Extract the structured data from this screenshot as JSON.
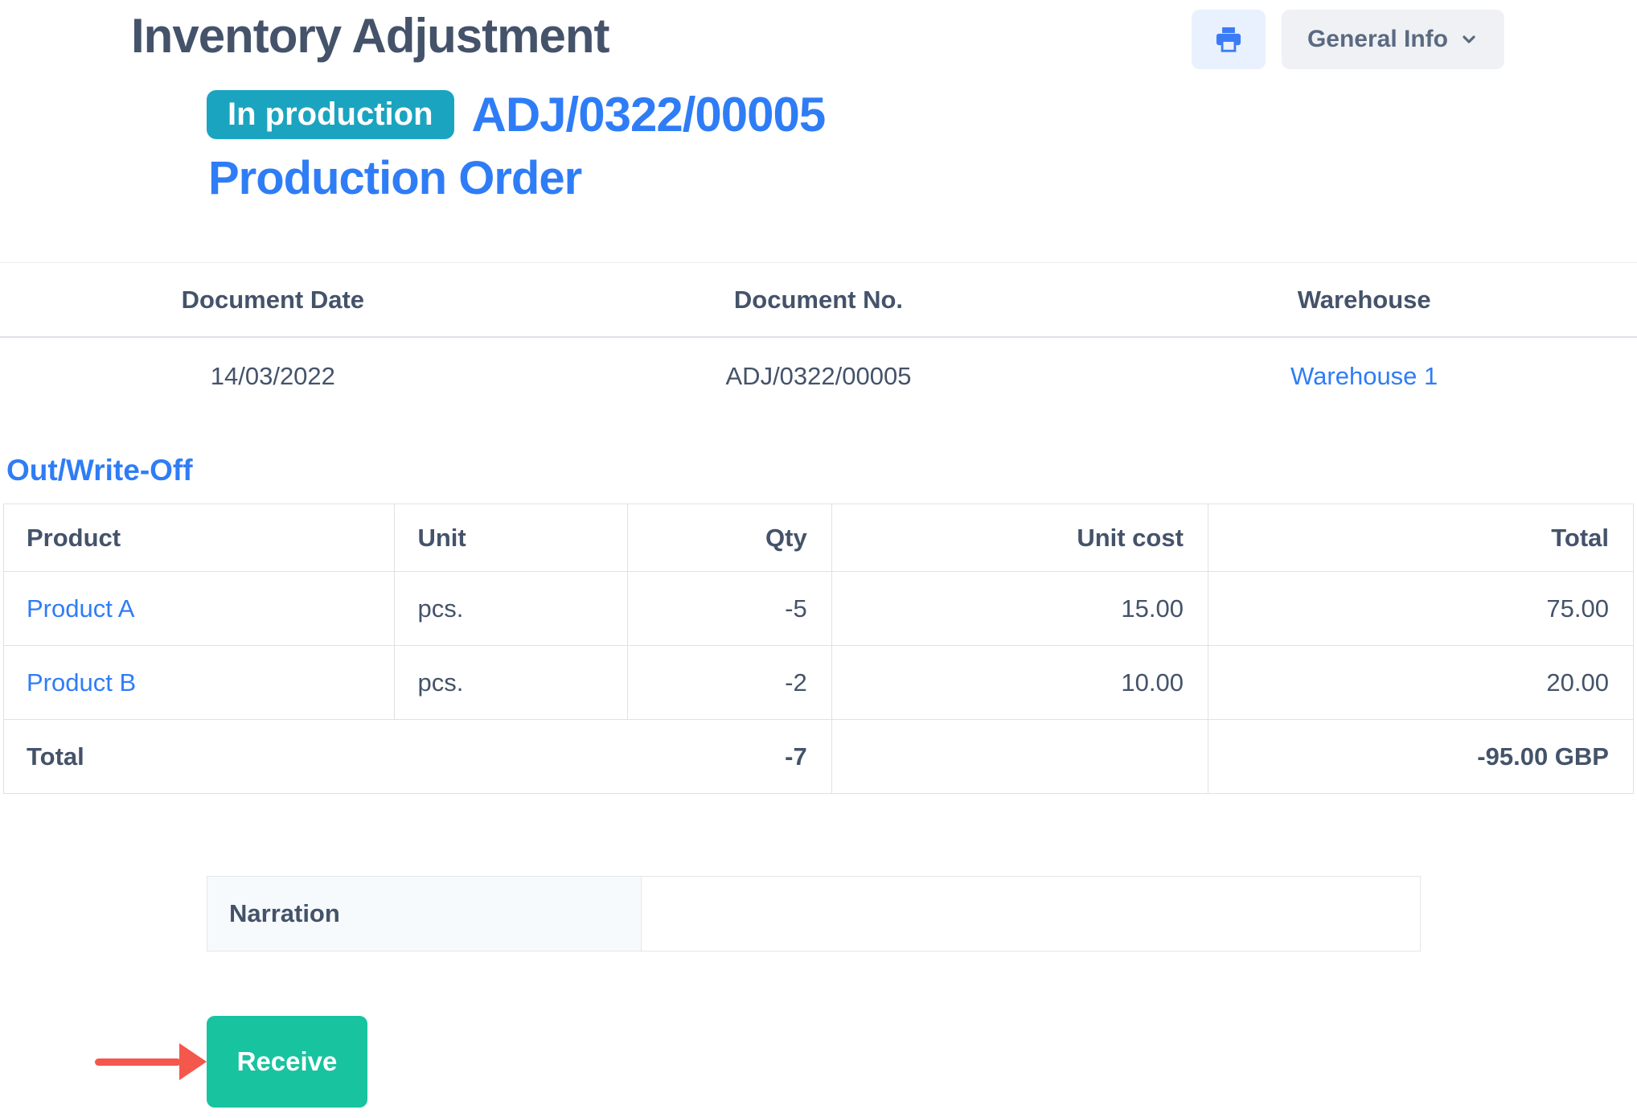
{
  "header": {
    "title": "Inventory Adjustment",
    "status_badge": "In production",
    "document_number": "ADJ/0322/00005",
    "order_link": "Production Order",
    "general_info_label": "General Info"
  },
  "icons": {
    "print": "printer-icon",
    "general_info_dropdown": "chevron-down-icon",
    "annotation": "red-arrow-right-icon"
  },
  "info_table": {
    "headers": [
      "Document Date",
      "Document No.",
      "Warehouse"
    ],
    "values": {
      "document_date": "14/03/2022",
      "document_no": "ADJ/0322/00005",
      "warehouse": "Warehouse 1"
    }
  },
  "section": {
    "title": "Out/Write-Off"
  },
  "items_table": {
    "headers": [
      "Product",
      "Unit",
      "Qty",
      "Unit cost",
      "Total"
    ],
    "rows": [
      {
        "product": "Product A",
        "unit": "pcs.",
        "qty": "-5",
        "unit_cost": "15.00",
        "total": "75.00"
      },
      {
        "product": "Product B",
        "unit": "pcs.",
        "qty": "-2",
        "unit_cost": "10.00",
        "total": "20.00"
      }
    ],
    "total_row": {
      "label": "Total",
      "qty": "-7",
      "unit_cost": "",
      "total": "-95.00 GBP"
    }
  },
  "narration": {
    "label": "Narration",
    "value": ""
  },
  "actions": {
    "receive_label": "Receive"
  },
  "colors": {
    "accent_blue": "#2f7df6",
    "badge_teal": "#1ba4bf",
    "receive_green": "#18c39f",
    "arrow_red": "#f4574c",
    "text_dark": "#44536a"
  }
}
